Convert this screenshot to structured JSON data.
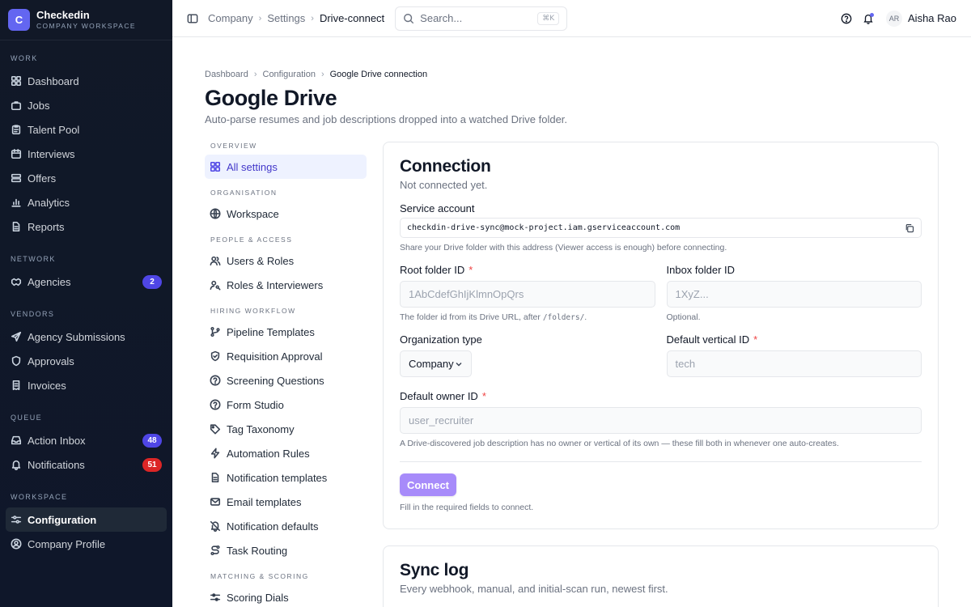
{
  "brand": {
    "logo_letter": "C",
    "name": "Checkedin",
    "subtitle": "COMPANY WORKSPACE"
  },
  "sidebar": {
    "sections": [
      {
        "title": "WORK",
        "items": [
          {
            "label": "Dashboard",
            "icon": "grid-icon"
          },
          {
            "label": "Jobs",
            "icon": "briefcase-icon"
          },
          {
            "label": "Talent Pool",
            "icon": "clipboard-icon"
          },
          {
            "label": "Interviews",
            "icon": "calendar-icon"
          },
          {
            "label": "Offers",
            "icon": "stack-icon"
          },
          {
            "label": "Analytics",
            "icon": "chart-icon"
          },
          {
            "label": "Reports",
            "icon": "document-icon"
          }
        ]
      },
      {
        "title": "NETWORK",
        "items": [
          {
            "label": "Agencies",
            "icon": "handshake-icon",
            "badge": "2",
            "badge_color": "#4f46e5"
          }
        ]
      },
      {
        "title": "VENDORS",
        "items": [
          {
            "label": "Agency Submissions",
            "icon": "send-icon"
          },
          {
            "label": "Approvals",
            "icon": "shield-icon"
          },
          {
            "label": "Invoices",
            "icon": "receipt-icon"
          }
        ]
      },
      {
        "title": "QUEUE",
        "items": [
          {
            "label": "Action Inbox",
            "icon": "inbox-icon",
            "badge": "48",
            "badge_color": "#4f46e5"
          },
          {
            "label": "Notifications",
            "icon": "bell-icon",
            "badge": "51",
            "badge_color": "#dc2626"
          }
        ]
      },
      {
        "title": "WORKSPACE",
        "items": [
          {
            "label": "Configuration",
            "icon": "sliders-icon",
            "active": true
          },
          {
            "label": "Company Profile",
            "icon": "user-circle-icon"
          }
        ]
      }
    ]
  },
  "topbar": {
    "breadcrumb": [
      "Company",
      "Settings",
      "Drive-connect"
    ],
    "search_placeholder": "Search...",
    "search_shortcut": "⌘K",
    "user_initials": "AR",
    "user_name": "Aisha Rao"
  },
  "page": {
    "breadcrumb": [
      "Dashboard",
      "Configuration",
      "Google Drive connection"
    ],
    "title": "Google Drive",
    "subtitle": "Auto-parse resumes and job descriptions dropped into a watched Drive folder."
  },
  "settings_nav": {
    "sections": [
      {
        "title": "OVERVIEW",
        "items": [
          {
            "label": "All settings",
            "icon": "grid-icon",
            "active": true
          }
        ]
      },
      {
        "title": "ORGANISATION",
        "items": [
          {
            "label": "Workspace",
            "icon": "globe-icon"
          }
        ]
      },
      {
        "title": "PEOPLE & ACCESS",
        "items": [
          {
            "label": "Users & Roles",
            "icon": "users-icon"
          },
          {
            "label": "Roles & Interviewers",
            "icon": "user-key-icon"
          }
        ]
      },
      {
        "title": "HIRING WORKFLOW",
        "items": [
          {
            "label": "Pipeline Templates",
            "icon": "branch-icon"
          },
          {
            "label": "Requisition Approval",
            "icon": "shield-check-icon"
          },
          {
            "label": "Screening Questions",
            "icon": "question-circle-icon"
          },
          {
            "label": "Form Studio",
            "icon": "help-circle-icon"
          },
          {
            "label": "Tag Taxonomy",
            "icon": "tag-icon"
          },
          {
            "label": "Automation Rules",
            "icon": "zap-icon"
          },
          {
            "label": "Notification templates",
            "icon": "file-text-icon"
          },
          {
            "label": "Email templates",
            "icon": "mail-icon"
          },
          {
            "label": "Notification defaults",
            "icon": "bell-off-icon"
          },
          {
            "label": "Task Routing",
            "icon": "route-icon"
          }
        ]
      },
      {
        "title": "MATCHING & SCORING",
        "items": [
          {
            "label": "Scoring Dials",
            "icon": "sliders-icon"
          }
        ]
      }
    ]
  },
  "connection": {
    "title": "Connection",
    "status": "Not connected yet.",
    "service_account_label": "Service account",
    "service_account_value": "checkdin-drive-sync@mock-project.iam.gserviceaccount.com",
    "service_account_help": "Share your Drive folder with this address (Viewer access is enough) before connecting.",
    "root_folder_label": "Root folder ID",
    "root_folder_placeholder": "1AbCdefGhIjKlmnOpQrs",
    "root_folder_help_pre": "The folder id from its Drive URL, after ",
    "root_folder_help_code": "/folders/",
    "root_folder_help_post": ".",
    "inbox_folder_label": "Inbox folder ID",
    "inbox_folder_placeholder": "1XyZ...",
    "inbox_folder_help": "Optional.",
    "org_type_label": "Organization type",
    "org_type_value": "Company",
    "vertical_label": "Default vertical ID",
    "vertical_placeholder": "tech",
    "owner_label": "Default owner ID",
    "owner_placeholder": "user_recruiter",
    "owner_help": "A Drive-discovered job description has no owner or vertical of its own — these fill both in whenever one auto-creates.",
    "required_mark": "*",
    "connect_label": "Connect",
    "connect_help": "Fill in the required fields to connect."
  },
  "sync_log": {
    "title": "Sync log",
    "subtitle": "Every webhook, manual, and initial-scan run, newest first."
  }
}
